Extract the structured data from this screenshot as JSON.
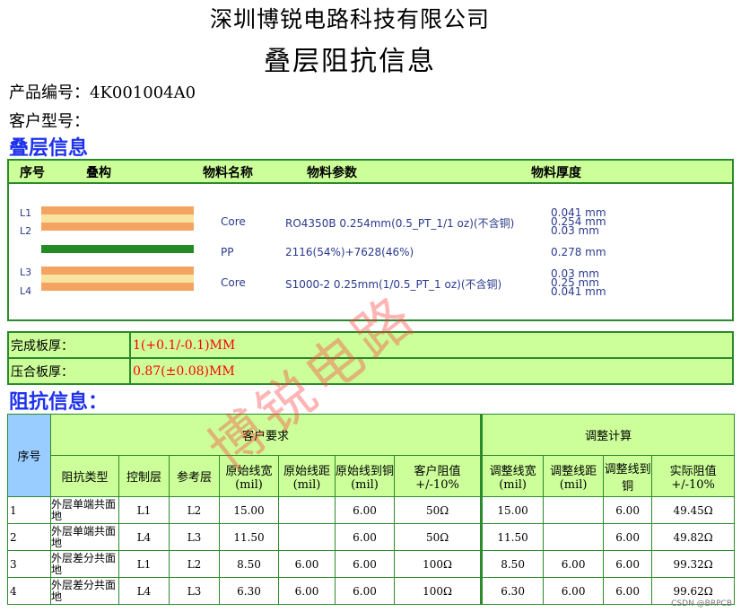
{
  "header": {
    "company": "深圳博锐电路科技有限公司",
    "title": "叠层阻抗信息"
  },
  "product": {
    "label": "产品编号：",
    "value": "4K001004A0"
  },
  "customer": {
    "label": "客户型号：",
    "value": ""
  },
  "stackup": {
    "heading": "叠层信息",
    "columns": [
      "序号",
      "叠构",
      "物料名称",
      "物料参数",
      "物料厚度"
    ],
    "layer_labels": [
      "L1",
      "L2",
      "L3",
      "L4"
    ],
    "rows": [
      {
        "name": "Core",
        "param": "RO4350B 0.254mm(0.5_PT_1/1 oz)(不含铜)",
        "thickness": [
          "0.041 mm",
          "0.254 mm",
          "0.03 mm"
        ]
      },
      {
        "name": "PP",
        "param": "2116(54%)+7628(46%)",
        "thickness": [
          "0.278 mm"
        ]
      },
      {
        "name": "Core",
        "param": "S1000-2 0.25mm(1/0.5_PT_1 oz)(不含铜)",
        "thickness": [
          "0.03 mm",
          "0.25 mm",
          "0.041 mm"
        ]
      }
    ],
    "colors": {
      "copper": "#f4a460",
      "core": "#f8e4a0",
      "pp": "#228b22"
    }
  },
  "board": {
    "finished": {
      "label": "完成板厚：",
      "value": "1(+0.1/-0.1)MM"
    },
    "pressed": {
      "label": "压合板厚：",
      "value": "0.87(±0.08)MM"
    }
  },
  "impedance": {
    "heading": "阻抗信息：",
    "no_label": "序号",
    "group_customer": "客户要求",
    "group_adjust": "调整计算",
    "columns": {
      "type": "阻抗类型",
      "ctrl": "控制层",
      "ref": "参考层",
      "orig_width": "原始线宽(mil)",
      "orig_space": "原始线距(mil)",
      "orig_copper": "原始线到铜(mil)",
      "cust_imp": "客户阻值+/-10%",
      "adj_width": "调整线宽(mil)",
      "adj_space": "调整线距(mil)",
      "adj_copper": "调整线到铜",
      "actual_imp": "实际阻值+/-10%"
    },
    "rows": [
      {
        "no": "1",
        "type": "外层单端共面地",
        "ctrl": "L1",
        "ref": "L2",
        "ow": "15.00",
        "os": "",
        "oc": "6.00",
        "ci": "50Ω",
        "aw": "15.00",
        "as": "",
        "ac": "6.00",
        "ai": "49.45Ω"
      },
      {
        "no": "2",
        "type": "外层单端共面地",
        "ctrl": "L4",
        "ref": "L3",
        "ow": "11.50",
        "os": "",
        "oc": "6.00",
        "ci": "50Ω",
        "aw": "11.50",
        "as": "",
        "ac": "6.00",
        "ai": "49.82Ω"
      },
      {
        "no": "3",
        "type": "外层差分共面地",
        "ctrl": "L1",
        "ref": "L2",
        "ow": "8.50",
        "os": "6.00",
        "oc": "6.00",
        "ci": "100Ω",
        "aw": "8.50",
        "as": "6.00",
        "ac": "6.00",
        "ai": "99.32Ω"
      },
      {
        "no": "4",
        "type": "外层差分共面地",
        "ctrl": "L4",
        "ref": "L3",
        "ow": "6.30",
        "os": "6.00",
        "oc": "6.00",
        "ci": "100Ω",
        "aw": "6.30",
        "as": "6.00",
        "ac": "6.00",
        "ai": "99.62Ω"
      }
    ]
  },
  "watermark": "博锐电路",
  "credit": "CSDN @BRPCB"
}
